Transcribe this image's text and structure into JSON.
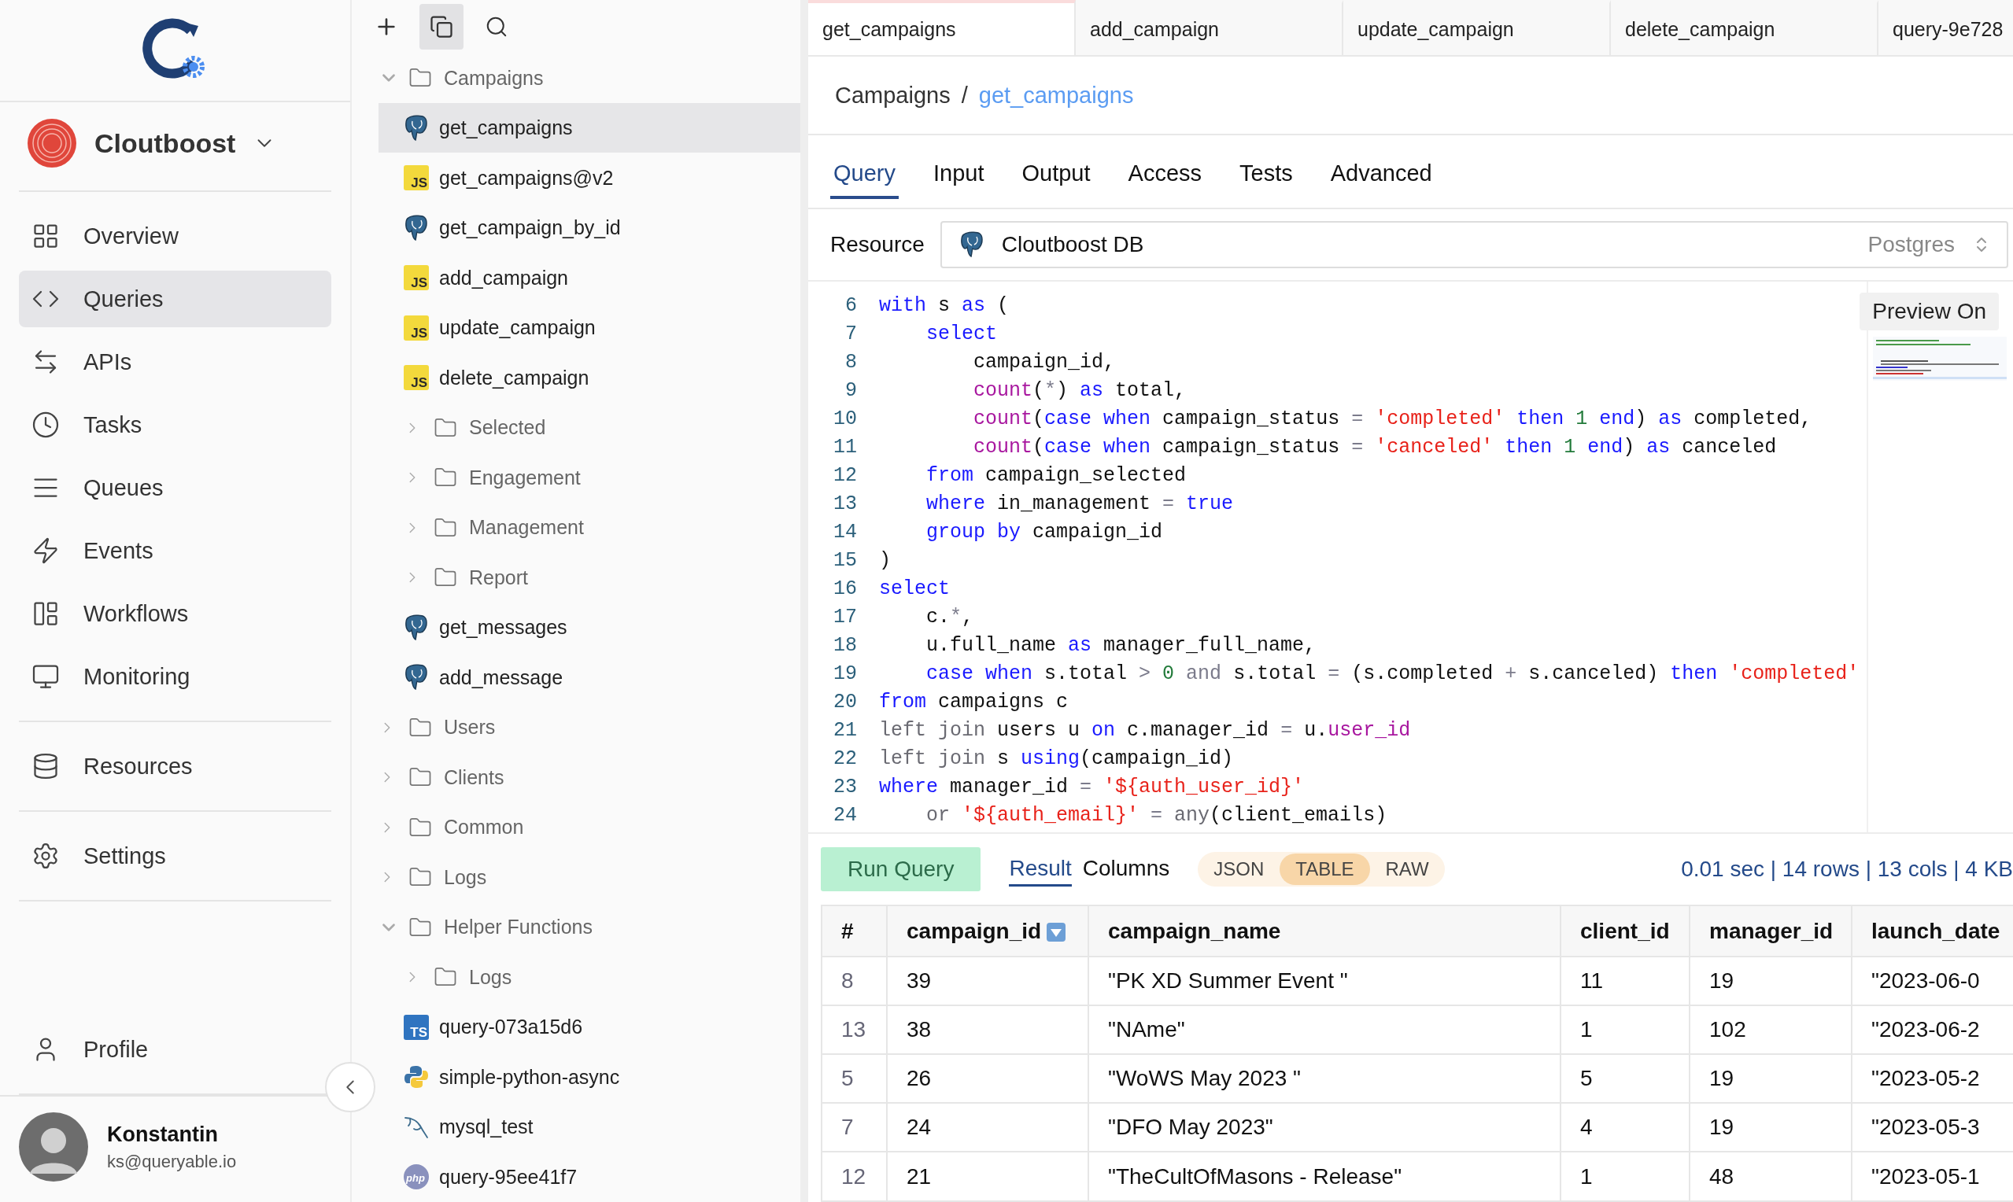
{
  "nav": {
    "org": {
      "name": "Cloutboost"
    },
    "groups": [
      [
        {
          "label": "Overview",
          "selected": false
        },
        {
          "label": "Queries",
          "selected": true
        },
        {
          "label": "APIs",
          "selected": false
        },
        {
          "label": "Tasks",
          "selected": false
        },
        {
          "label": "Queues",
          "selected": false
        },
        {
          "label": "Events",
          "selected": false
        },
        {
          "label": "Workflows",
          "selected": false
        },
        {
          "label": "Monitoring",
          "selected": false
        }
      ],
      [
        {
          "label": "Resources",
          "selected": false
        }
      ],
      [
        {
          "label": "Settings",
          "selected": false
        }
      ]
    ],
    "profile": {
      "label": "Profile",
      "selected": false
    },
    "user": {
      "name": "Konstantin",
      "email": "ks@queryable.io"
    }
  },
  "tree": {
    "items": [
      {
        "kind": "folder",
        "label": "Campaigns",
        "expanded": true,
        "children": [
          {
            "kind": "postgres",
            "label": "get_campaigns",
            "selected": true
          },
          {
            "kind": "js",
            "badge": "JS",
            "label": "get_campaigns@v2",
            "selected": false
          },
          {
            "kind": "postgres",
            "label": "get_campaign_by_id",
            "selected": false
          },
          {
            "kind": "js",
            "badge": "JS",
            "label": "add_campaign",
            "selected": false
          },
          {
            "kind": "js",
            "badge": "JS",
            "label": "update_campaign",
            "selected": false
          },
          {
            "kind": "js",
            "badge": "JS",
            "label": "delete_campaign",
            "selected": false
          },
          {
            "kind": "folder",
            "label": "Selected",
            "expanded": false
          },
          {
            "kind": "folder",
            "label": "Engagement",
            "expanded": false
          },
          {
            "kind": "folder",
            "label": "Management",
            "expanded": false
          },
          {
            "kind": "folder",
            "label": "Report",
            "expanded": false
          },
          {
            "kind": "postgres",
            "label": "get_messages",
            "selected": false
          },
          {
            "kind": "postgres",
            "label": "add_message",
            "selected": false
          }
        ]
      },
      {
        "kind": "folder",
        "label": "Users",
        "expanded": false
      },
      {
        "kind": "folder",
        "label": "Clients",
        "expanded": false
      },
      {
        "kind": "folder",
        "label": "Common",
        "expanded": false
      },
      {
        "kind": "folder",
        "label": "Logs",
        "expanded": false
      },
      {
        "kind": "folder",
        "label": "Helper Functions",
        "expanded": true,
        "children": [
          {
            "kind": "folder",
            "label": "Logs",
            "expanded": false
          },
          {
            "kind": "ts",
            "badge": "TS",
            "label": "query-073a15d6",
            "selected": false
          },
          {
            "kind": "python",
            "label": "simple-python-async",
            "selected": false
          },
          {
            "kind": "mysql",
            "label": "mysql_test",
            "selected": false
          },
          {
            "kind": "php",
            "badge": "php",
            "label": "query-95ee41f7",
            "selected": false
          }
        ]
      }
    ]
  },
  "tabs": [
    {
      "label": "get_campaigns",
      "selected": true
    },
    {
      "label": "add_campaign",
      "selected": false
    },
    {
      "label": "update_campaign",
      "selected": false
    },
    {
      "label": "delete_campaign",
      "selected": false
    },
    {
      "label": "query-9e728",
      "selected": false
    }
  ],
  "breadcrumb": {
    "parent": "Campaigns",
    "separator": "/",
    "current": "get_campaigns"
  },
  "subtabs": [
    {
      "label": "Query",
      "selected": true
    },
    {
      "label": "Input",
      "selected": false
    },
    {
      "label": "Output",
      "selected": false
    },
    {
      "label": "Access",
      "selected": false
    },
    {
      "label": "Tests",
      "selected": false
    },
    {
      "label": "Advanced",
      "selected": false
    }
  ],
  "resource": {
    "label": "Resource",
    "name": "Cloutboost DB",
    "type": "Postgres"
  },
  "editor": {
    "preview_button": "Preview On",
    "lines": [
      {
        "number": "6",
        "tokens": [
          {
            "kind": "kw",
            "text": "with"
          },
          {
            "kind": "plain",
            "text": " s "
          },
          {
            "kind": "kw",
            "text": "as"
          },
          {
            "kind": "plain",
            "text": " ("
          }
        ]
      },
      {
        "number": "7",
        "tokens": [
          {
            "kind": "kw",
            "text": "    select"
          }
        ]
      },
      {
        "number": "8",
        "tokens": [
          {
            "kind": "plain",
            "text": "        campaign_id,"
          }
        ]
      },
      {
        "number": "9",
        "tokens": [
          {
            "kind": "fn",
            "text": "        count"
          },
          {
            "kind": "plain",
            "text": "("
          },
          {
            "kind": "op",
            "text": "*"
          },
          {
            "kind": "plain",
            "text": ") "
          },
          {
            "kind": "kw",
            "text": "as"
          },
          {
            "kind": "plain",
            "text": " total,"
          }
        ]
      },
      {
        "number": "10",
        "tokens": [
          {
            "kind": "fn",
            "text": "        count"
          },
          {
            "kind": "plain",
            "text": "("
          },
          {
            "kind": "kw",
            "text": "case when"
          },
          {
            "kind": "plain",
            "text": " campaign_status "
          },
          {
            "kind": "op",
            "text": "="
          },
          {
            "kind": "str",
            "text": " 'completed'"
          },
          {
            "kind": "kw",
            "text": " then"
          },
          {
            "kind": "num",
            "text": " 1"
          },
          {
            "kind": "kw",
            "text": " end"
          },
          {
            "kind": "plain",
            "text": ") "
          },
          {
            "kind": "kw",
            "text": "as"
          },
          {
            "kind": "plain",
            "text": " completed,"
          }
        ]
      },
      {
        "number": "11",
        "tokens": [
          {
            "kind": "fn",
            "text": "        count"
          },
          {
            "kind": "plain",
            "text": "("
          },
          {
            "kind": "kw",
            "text": "case when"
          },
          {
            "kind": "plain",
            "text": " campaign_status "
          },
          {
            "kind": "op",
            "text": "="
          },
          {
            "kind": "str",
            "text": " 'canceled'"
          },
          {
            "kind": "kw",
            "text": " then"
          },
          {
            "kind": "num",
            "text": " 1"
          },
          {
            "kind": "kw",
            "text": " end"
          },
          {
            "kind": "plain",
            "text": ") "
          },
          {
            "kind": "kw",
            "text": "as"
          },
          {
            "kind": "plain",
            "text": " canceled"
          }
        ]
      },
      {
        "number": "12",
        "tokens": [
          {
            "kind": "kw",
            "text": "    from"
          },
          {
            "kind": "plain",
            "text": " campaign_selected"
          }
        ]
      },
      {
        "number": "13",
        "tokens": [
          {
            "kind": "kw",
            "text": "    where"
          },
          {
            "kind": "plain",
            "text": " in_management "
          },
          {
            "kind": "op",
            "text": "="
          },
          {
            "kind": "kw",
            "text": " true"
          }
        ]
      },
      {
        "number": "14",
        "tokens": [
          {
            "kind": "kw",
            "text": "    group by"
          },
          {
            "kind": "plain",
            "text": " campaign_id"
          }
        ]
      },
      {
        "number": "15",
        "tokens": [
          {
            "kind": "plain",
            "text": ")"
          }
        ]
      },
      {
        "number": "16",
        "tokens": [
          {
            "kind": "kw",
            "text": "select"
          }
        ]
      },
      {
        "number": "17",
        "tokens": [
          {
            "kind": "plain",
            "text": "    c."
          },
          {
            "kind": "op",
            "text": "*"
          },
          {
            "kind": "plain",
            "text": ","
          }
        ]
      },
      {
        "number": "18",
        "tokens": [
          {
            "kind": "plain",
            "text": "    u.full_name "
          },
          {
            "kind": "kw",
            "text": "as"
          },
          {
            "kind": "plain",
            "text": " manager_full_name,"
          }
        ]
      },
      {
        "number": "19",
        "tokens": [
          {
            "kind": "kw",
            "text": "    case when"
          },
          {
            "kind": "plain",
            "text": " s.total "
          },
          {
            "kind": "op",
            "text": ">"
          },
          {
            "kind": "num",
            "text": " 0"
          },
          {
            "kind": "op",
            "text": " and"
          },
          {
            "kind": "plain",
            "text": " s.total "
          },
          {
            "kind": "op",
            "text": "="
          },
          {
            "kind": "plain",
            "text": " (s.completed "
          },
          {
            "kind": "op",
            "text": "+"
          },
          {
            "kind": "plain",
            "text": " s.canceled) "
          },
          {
            "kind": "kw",
            "text": "then"
          },
          {
            "kind": "str",
            "text": " 'completed'"
          }
        ]
      },
      {
        "number": "20",
        "tokens": [
          {
            "kind": "kw",
            "text": "from"
          },
          {
            "kind": "plain",
            "text": " campaigns c"
          }
        ]
      },
      {
        "number": "21",
        "tokens": [
          {
            "kind": "dim",
            "text": "left join"
          },
          {
            "kind": "plain",
            "text": " users u "
          },
          {
            "kind": "kw",
            "text": "on"
          },
          {
            "kind": "plain",
            "text": " c.manager_id "
          },
          {
            "kind": "op",
            "text": "="
          },
          {
            "kind": "plain",
            "text": " u."
          },
          {
            "kind": "fn",
            "text": "user_id"
          }
        ]
      },
      {
        "number": "22",
        "tokens": [
          {
            "kind": "dim",
            "text": "left join"
          },
          {
            "kind": "plain",
            "text": " s "
          },
          {
            "kind": "kw",
            "text": "using"
          },
          {
            "kind": "plain",
            "text": "(campaign_id)"
          }
        ]
      },
      {
        "number": "23",
        "tokens": [
          {
            "kind": "kw",
            "text": "where"
          },
          {
            "kind": "plain",
            "text": " manager_id "
          },
          {
            "kind": "op",
            "text": "="
          },
          {
            "kind": "str",
            "text": " '${auth_user_id}'"
          }
        ]
      },
      {
        "number": "24",
        "tokens": [
          {
            "kind": "dim",
            "text": "    or"
          },
          {
            "kind": "str",
            "text": " '${auth_email}'"
          },
          {
            "kind": "op",
            "text": " ="
          },
          {
            "kind": "dim",
            "text": " any"
          },
          {
            "kind": "plain",
            "text": "(client_emails)"
          }
        ]
      }
    ]
  },
  "results": {
    "run_button": "Run Query",
    "views": [
      {
        "label": "Result",
        "selected": true
      },
      {
        "label": "Columns",
        "selected": false
      }
    ],
    "formats": [
      {
        "label": "JSON",
        "selected": false
      },
      {
        "label": "TABLE",
        "selected": true
      },
      {
        "label": "RAW",
        "selected": false
      }
    ],
    "stats": "0.01 sec | 14 rows | 13 cols | 4 KB",
    "table": {
      "columns": [
        {
          "label": "#",
          "sorted": false
        },
        {
          "label": "campaign_id",
          "sorted": true
        },
        {
          "label": "campaign_name",
          "sorted": false
        },
        {
          "label": "client_id",
          "sorted": false
        },
        {
          "label": "manager_id",
          "sorted": false
        },
        {
          "label": "launch_date",
          "sorted": false
        }
      ],
      "rows": [
        [
          "8",
          "39",
          "\"PK XD Summer Event \"",
          "11",
          "19",
          "\"2023-06-0"
        ],
        [
          "13",
          "38",
          "\"NAme\"",
          "1",
          "102",
          "\"2023-06-2"
        ],
        [
          "5",
          "26",
          "\"WoWS May 2023 \"",
          "5",
          "19",
          "\"2023-05-2"
        ],
        [
          "7",
          "24",
          "\"DFO May 2023\"",
          "4",
          "19",
          "\"2023-05-3"
        ],
        [
          "12",
          "21",
          "\"TheCultOfMasons - Release\"",
          "1",
          "48",
          "\"2023-05-1"
        ]
      ]
    }
  }
}
